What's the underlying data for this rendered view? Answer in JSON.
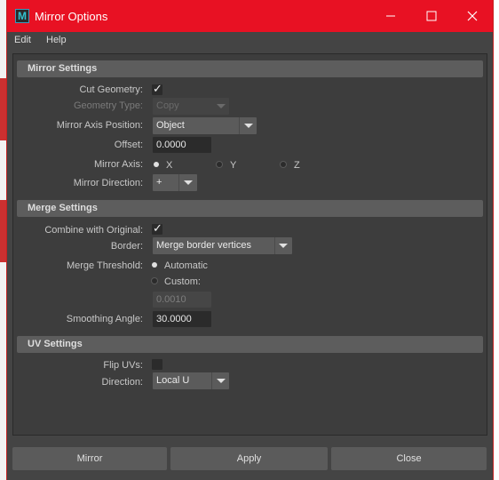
{
  "window": {
    "title": "Mirror Options"
  },
  "menu": {
    "edit": "Edit",
    "help": "Help"
  },
  "mirror_settings": {
    "header": "Mirror Settings",
    "cut_geometry_label": "Cut Geometry:",
    "cut_geometry_checked": true,
    "geometry_type_label": "Geometry Type:",
    "geometry_type_value": "Copy",
    "axis_position_label": "Mirror Axis Position:",
    "axis_position_value": "Object",
    "offset_label": "Offset:",
    "offset_value": "0.0000",
    "axis_label": "Mirror Axis:",
    "axis_options": [
      "X",
      "Y",
      "Z"
    ],
    "axis_selected": "X",
    "direction_label": "Mirror Direction:",
    "direction_value": "+"
  },
  "merge_settings": {
    "header": "Merge Settings",
    "combine_label": "Combine with Original:",
    "combine_checked": true,
    "border_label": "Border:",
    "border_value": "Merge border vertices",
    "threshold_label": "Merge Threshold:",
    "threshold_auto": "Automatic",
    "threshold_custom": "Custom:",
    "threshold_custom_value": "0.0010",
    "smoothing_label": "Smoothing Angle:",
    "smoothing_value": "30.0000"
  },
  "uv_settings": {
    "header": "UV Settings",
    "flip_label": "Flip UVs:",
    "flip_checked": false,
    "direction_label": "Direction:",
    "direction_value": "Local U"
  },
  "buttons": {
    "mirror": "Mirror",
    "apply": "Apply",
    "close": "Close"
  },
  "colors": {
    "titlebar": "#e81123",
    "panel": "#3d3d3d",
    "section_header": "#5d5d5d"
  }
}
